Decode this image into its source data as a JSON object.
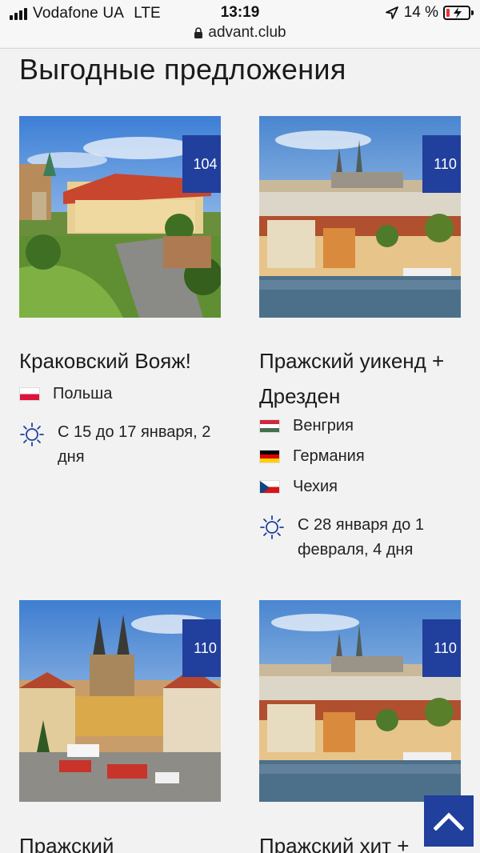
{
  "status_bar": {
    "carrier": "Vodafone UA",
    "network": "LTE",
    "time": "13:19",
    "battery": "14 %"
  },
  "browser": {
    "url": "advant.club"
  },
  "section_title": "Выгодные предложения",
  "colors": {
    "accent": "#213f9c",
    "background": "#f2f2f2"
  },
  "offers": [
    {
      "title": "Краковский Вояж!",
      "price": "104 €",
      "countries": [
        "Польша"
      ],
      "dates": "С 15 до 17 января, 2 дня"
    },
    {
      "title": "Пражский уикенд + Дрезден",
      "price": "110 €",
      "countries": [
        "Венгрия",
        "Германия",
        "Чехия"
      ],
      "dates": "С 28 января до 1 февраля, 4 дня"
    },
    {
      "title": "Пражский",
      "price": "110 €",
      "countries": [],
      "dates": ""
    },
    {
      "title": "Пражский хит +",
      "price": "110 €",
      "countries": [],
      "dates": ""
    }
  ],
  "icons": {
    "scroll_top": "chevron-up-icon",
    "dates": "sun-icon",
    "location": "location-arrow-icon",
    "lock": "lock-icon"
  }
}
